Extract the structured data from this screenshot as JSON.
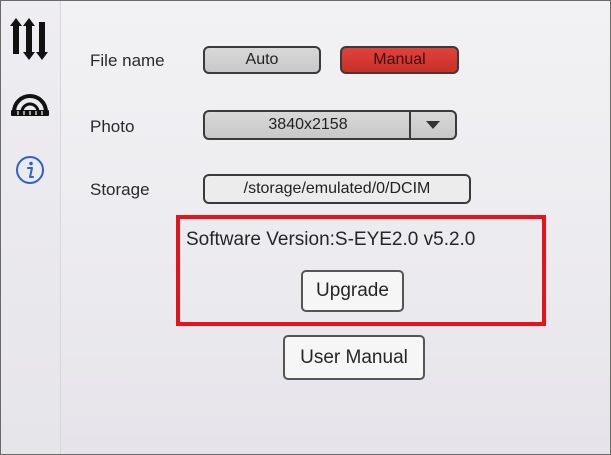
{
  "sidebar": {
    "items": [
      {
        "icon": "sliders-icon"
      },
      {
        "icon": "measure-gauge-icon"
      },
      {
        "icon": "info-icon"
      }
    ]
  },
  "settings": {
    "file_name": {
      "label": "File name",
      "options": [
        "Auto",
        "Manual"
      ],
      "selected": "Manual"
    },
    "photo": {
      "label": "Photo",
      "value": "3840x2158"
    },
    "storage": {
      "label": "Storage",
      "value": "/storage/emulated/0/DCIM"
    }
  },
  "software": {
    "version_text": "Software Version:S-EYE2.0 v5.2.0",
    "upgrade_label": "Upgrade",
    "manual_label": "User Manual"
  },
  "colors": {
    "highlight": "#e8121c",
    "active_button": "#d43a32"
  }
}
